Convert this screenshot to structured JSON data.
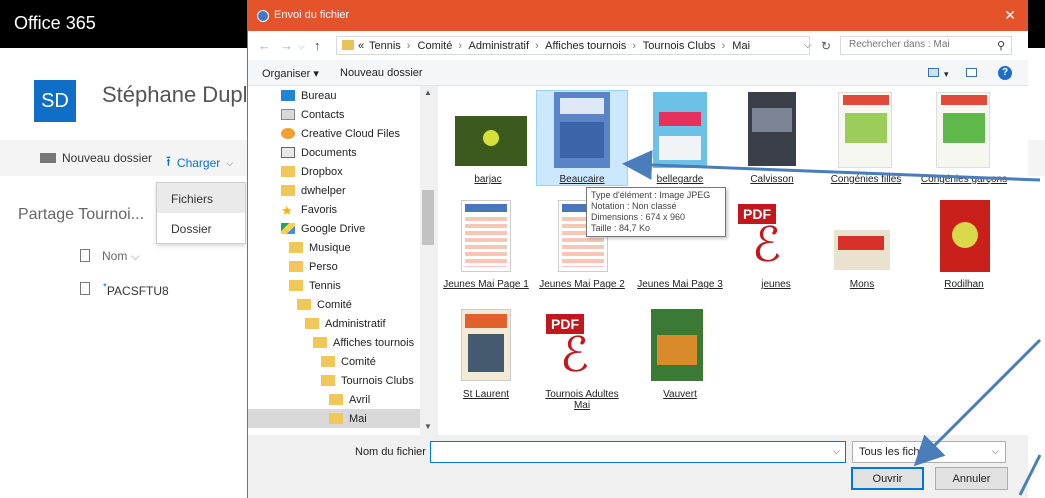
{
  "office": {
    "brand": "Office 365",
    "avatar_initials": "SD",
    "site_name": "Stéphane Dupli",
    "commands": {
      "new_folder": "Nouveau dossier",
      "upload": "Charger"
    },
    "upload_menu": [
      "Fichiers",
      "Dossier"
    ],
    "share_title": "Partage Tournoi...",
    "list_header": "Nom",
    "list_rows": [
      "PACSFTU8"
    ]
  },
  "dialog": {
    "title": "Envoi du fichier",
    "close_glyph": "✕",
    "breadcrumb": [
      "«",
      "Tennis",
      "Comité",
      "Administratif",
      "Affiches tournois",
      "Tournois Clubs",
      "Mai"
    ],
    "search_placeholder": "Rechercher dans : Mai",
    "toolbar": {
      "organize": "Organiser ▾",
      "new_folder": "Nouveau dossier",
      "help": "?"
    },
    "nav_items": [
      "Bureau",
      "Contacts",
      "Creative Cloud Files",
      "Documents",
      "Dropbox",
      "dwhelper",
      "Favoris",
      "Google Drive",
      "Musique",
      "Perso",
      "Tennis",
      "Comité",
      "Administratif",
      "Affiches tournois",
      "Comité",
      "Tournois Clubs",
      "Avril",
      "Mai"
    ],
    "files": [
      "barjac",
      "Beaucaire",
      "bellegarde",
      "Calvisson",
      "Congénies filles",
      "Congénies garçons",
      "Jeunes Mai Page 1",
      "Jeunes Mai Page 2",
      "Jeunes Mai Page 3",
      "jeunes",
      "Mons",
      "Rodilhan",
      "St Laurent",
      "Tournois Adultes Mai",
      "Vauvert"
    ],
    "pdf_label": "PDF",
    "tooltip": {
      "type": "Type d'élément : Image JPEG",
      "rating": "Notation : Non classé",
      "dimensions": "Dimensions : 674 x 960",
      "size": "Taille : 84,7 Ko"
    },
    "filename_label": "Nom du fichier :",
    "filename_value": "",
    "filetype": "Tous les fichiers",
    "open_button": "Ouvrir",
    "cancel_button": "Annuler"
  },
  "colors": {
    "accent": "#e4532a",
    "selection": "#cce8ff",
    "link_blue": "#0f6fc6",
    "arrow": "#4a7ebb"
  }
}
